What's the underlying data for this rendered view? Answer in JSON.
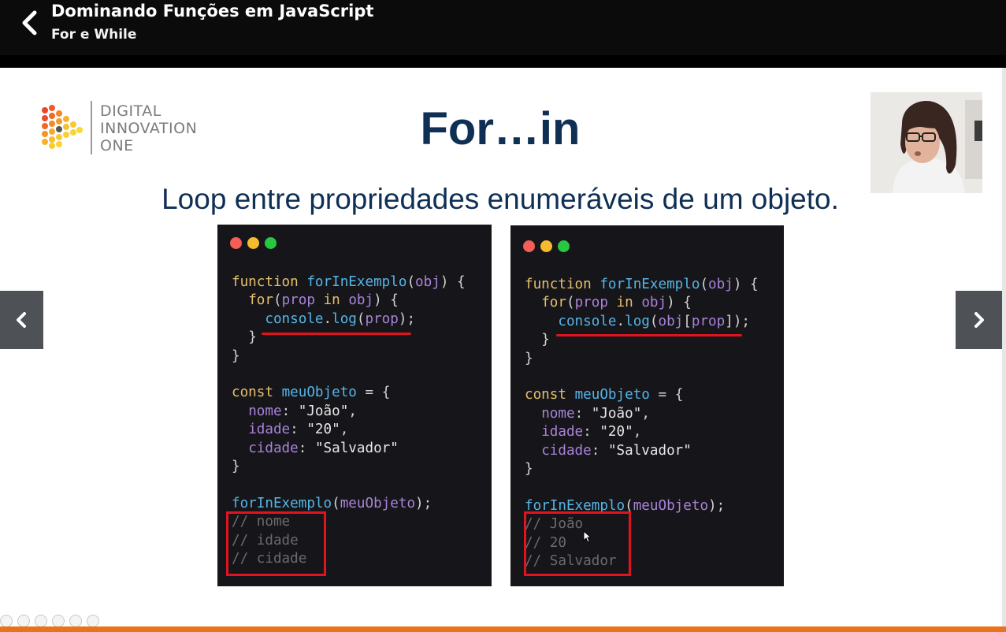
{
  "header": {
    "title": "Dominando Funções em JavaScript",
    "subtitle": "For e While"
  },
  "slide": {
    "logo": {
      "lines": [
        "DIGITAL",
        "INNOVATION",
        "ONE"
      ]
    },
    "title": "For…in",
    "subtitle": "Loop entre propriedades enumeráveis de um objeto."
  },
  "code_left": {
    "line1": [
      "function",
      "forInExemplo",
      "(",
      "obj",
      ") {"
    ],
    "line2": [
      "for",
      "(",
      "prop",
      "in",
      "obj",
      ") {"
    ],
    "line3": [
      "console",
      ".",
      "log",
      "(",
      "prop",
      ");"
    ],
    "line4": "}",
    "line5": "}",
    "line7": [
      "const",
      "meuObjeto",
      "=",
      "{"
    ],
    "line8": [
      "nome",
      ":",
      "\"João\"",
      ","
    ],
    "line9": [
      "idade",
      ":",
      "\"20\"",
      ","
    ],
    "line10": [
      "cidade",
      ":",
      "\"Salvador\""
    ],
    "line11": "}",
    "line13": [
      "forInExemplo",
      "(",
      "meuObjeto",
      ");"
    ],
    "out1": "// nome",
    "out2": "// idade",
    "out3": "// cidade"
  },
  "code_right": {
    "line1": [
      "function",
      "forInExemplo",
      "(",
      "obj",
      ") {"
    ],
    "line2": [
      "for",
      "(",
      "prop",
      "in",
      "obj",
      ") {"
    ],
    "line3": [
      "console",
      ".",
      "log",
      "(",
      "obj",
      "[",
      "prop",
      "]);"
    ],
    "line4": "}",
    "line5": "}",
    "line7": [
      "const",
      "meuObjeto",
      "=",
      "{"
    ],
    "line8": [
      "nome",
      ":",
      "\"João\"",
      ","
    ],
    "line9": [
      "idade",
      ":",
      "\"20\"",
      ","
    ],
    "line10": [
      "cidade",
      ":",
      "\"Salvador\""
    ],
    "line11": "}",
    "line13": [
      "forInExemplo",
      "(",
      "meuObjeto",
      ");"
    ],
    "out1": "// João",
    "out2": "// 20",
    "out3": "// Salvador"
  },
  "colors": {
    "accent_orange": "#e8731a",
    "title_navy": "#0f2f55",
    "highlight_red": "#e0141e",
    "code_bg": "#16161a"
  }
}
